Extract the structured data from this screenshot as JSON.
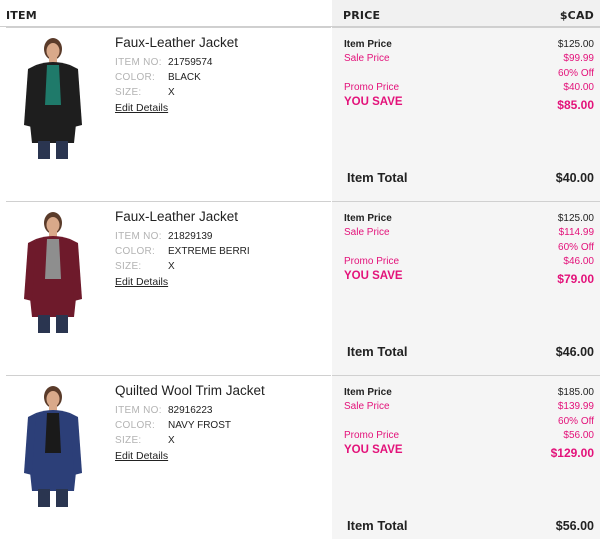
{
  "header": {
    "item": "ITEM",
    "price": "PRICE",
    "currency": "$CAD"
  },
  "labels": {
    "item_no": "ITEM NO:",
    "color": "COLOR:",
    "size": "SIZE:",
    "edit": "Edit Details",
    "item_price": "Item Price",
    "sale_price": "Sale Price",
    "promo_price": "Promo Price",
    "you_save": "YOU SAVE",
    "item_total": "Item Total"
  },
  "items": [
    {
      "name": "Faux-Leather Jacket",
      "item_no": "21759574",
      "color": "BLACK",
      "size": "X",
      "item_price": "$125.00",
      "sale_price": "$99.99",
      "discount": "60% Off",
      "promo_price": "$40.00",
      "you_save": "$85.00",
      "total": "$40.00",
      "image": {
        "icon": "model-black-leather-jacket",
        "jacket_color": "#1e1e1e",
        "top_color": "#1f7a6a"
      }
    },
    {
      "name": "Faux-Leather Jacket",
      "item_no": "21829139",
      "color": "EXTREME BERRI",
      "size": "X",
      "item_price": "$125.00",
      "sale_price": "$114.99",
      "discount": "60% Off",
      "promo_price": "$46.00",
      "you_save": "$79.00",
      "total": "$46.00",
      "image": {
        "icon": "model-berry-leather-jacket",
        "jacket_color": "#6e1a2b",
        "top_color": "#8e8e8e"
      }
    },
    {
      "name": "Quilted Wool Trim Jacket",
      "item_no": "82916223",
      "color": "NAVY FROST",
      "size": "X",
      "item_price": "$185.00",
      "sale_price": "$139.99",
      "discount": "60% Off",
      "promo_price": "$56.00",
      "you_save": "$129.00",
      "total": "$56.00",
      "image": {
        "icon": "model-navy-quilted-jacket",
        "jacket_color": "#2c3f78",
        "top_color": "#1a1a1a"
      }
    }
  ],
  "colors": {
    "accent_pink": "#e3127a",
    "price_panel_bg": "#f5f5f5",
    "muted_label": "#b3b3b3"
  }
}
